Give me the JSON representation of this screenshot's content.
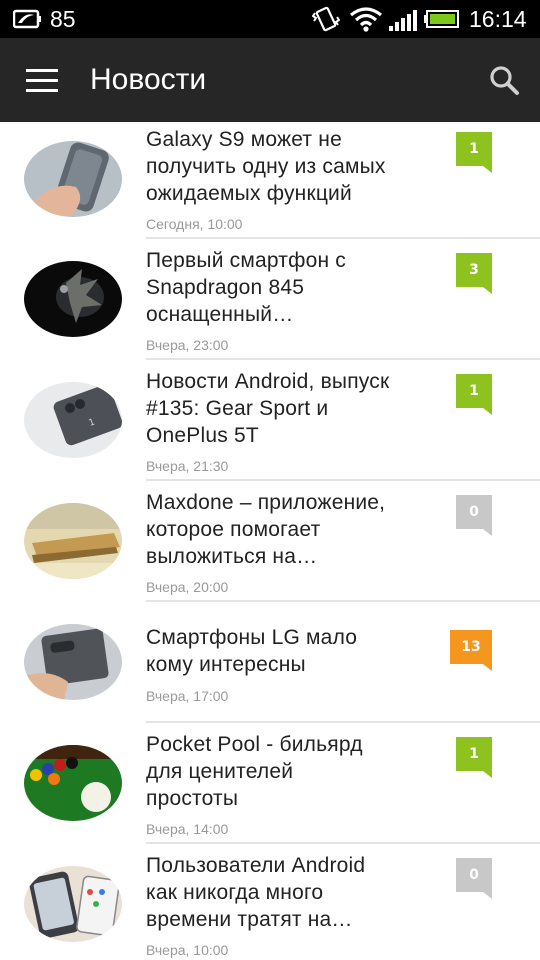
{
  "status_bar": {
    "battery_percent": "85",
    "time": "16:14",
    "icons": [
      "battery-saver-icon",
      "vibrate-icon",
      "wifi-icon",
      "signal-icon",
      "battery-icon"
    ]
  },
  "app_bar": {
    "title": "Новости",
    "menu_icon": "hamburger-menu-icon",
    "search_icon": "search-icon"
  },
  "colors": {
    "appbar": "#262626",
    "statusbar": "#000000",
    "badge_green": "#8dc21f",
    "badge_orange": "#f5961e",
    "badge_gray": "#c8c8c8"
  },
  "news": [
    {
      "title_lines": [
        "Galaxy S9 может не",
        "получить одну из самых",
        "ожидаемых функций"
      ],
      "date": "Сегодня, 10:00",
      "comments": "1",
      "badge": "green"
    },
    {
      "title_lines": [
        "Первый смартфон с",
        "Snapdragon 845",
        "оснащенный…"
      ],
      "date": "Вчера, 23:00",
      "comments": "3",
      "badge": "green"
    },
    {
      "title_lines": [
        "Новости Android, выпуск",
        "#135: Gear Sport и",
        "OnePlus 5T"
      ],
      "date": "Вчера, 21:30",
      "comments": "1",
      "badge": "green"
    },
    {
      "title_lines": [
        "Maxdone – приложение,",
        "которое помогает",
        "выложиться на…"
      ],
      "date": "Вчера, 20:00",
      "comments": "0",
      "badge": "gray"
    },
    {
      "title_lines": [
        "Смартфоны LG мало",
        "кому интересны"
      ],
      "date": "Вчера, 17:00",
      "comments": "13",
      "badge": "orange"
    },
    {
      "title_lines": [
        "Pocket Pool - бильярд",
        "для ценителей",
        "простоты"
      ],
      "date": "Вчера, 14:00",
      "comments": "1",
      "badge": "green"
    },
    {
      "title_lines": [
        "Пользователи Android",
        "как никогда много",
        "времени тратят на…"
      ],
      "date": "Вчера, 10:00",
      "comments": "0",
      "badge": "gray"
    }
  ]
}
